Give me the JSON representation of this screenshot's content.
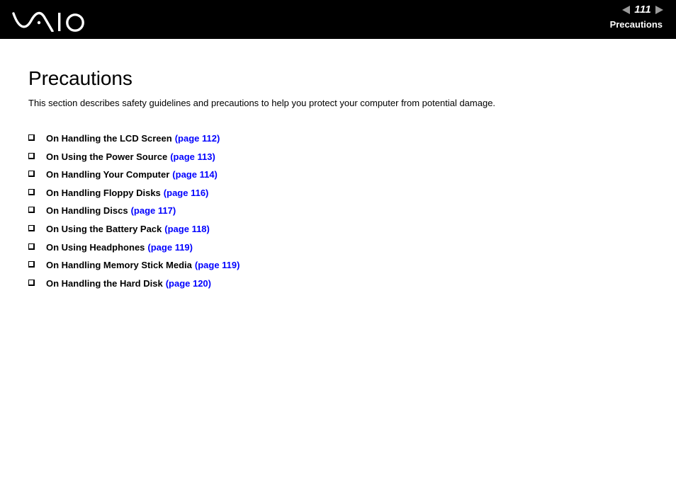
{
  "header": {
    "logo_alt": "VAIO",
    "prev_arrow": "◀",
    "next_arrow": "▶",
    "page_number": "111",
    "section_label": "Precautions"
  },
  "main": {
    "title": "Precautions",
    "intro": "This section describes safety guidelines and precautions to help you protect your computer from potential damage.",
    "link_color": "#0000ff",
    "items": [
      {
        "label": "On Handling the LCD Screen",
        "page_ref": "(page 112)"
      },
      {
        "label": "On Using the Power Source",
        "page_ref": "(page 113)"
      },
      {
        "label": "On Handling Your Computer",
        "page_ref": "(page 114)"
      },
      {
        "label": "On Handling Floppy Disks",
        "page_ref": "(page 116)"
      },
      {
        "label": "On Handling Discs",
        "page_ref": "(page 117)"
      },
      {
        "label": "On Using the Battery Pack",
        "page_ref": "(page 118)"
      },
      {
        "label": "On Using Headphones",
        "page_ref": "(page 119)"
      },
      {
        "label": "On Handling Memory Stick Media",
        "page_ref": "(page 119)"
      },
      {
        "label": "On Handling the Hard Disk",
        "page_ref": "(page 120)"
      }
    ]
  }
}
